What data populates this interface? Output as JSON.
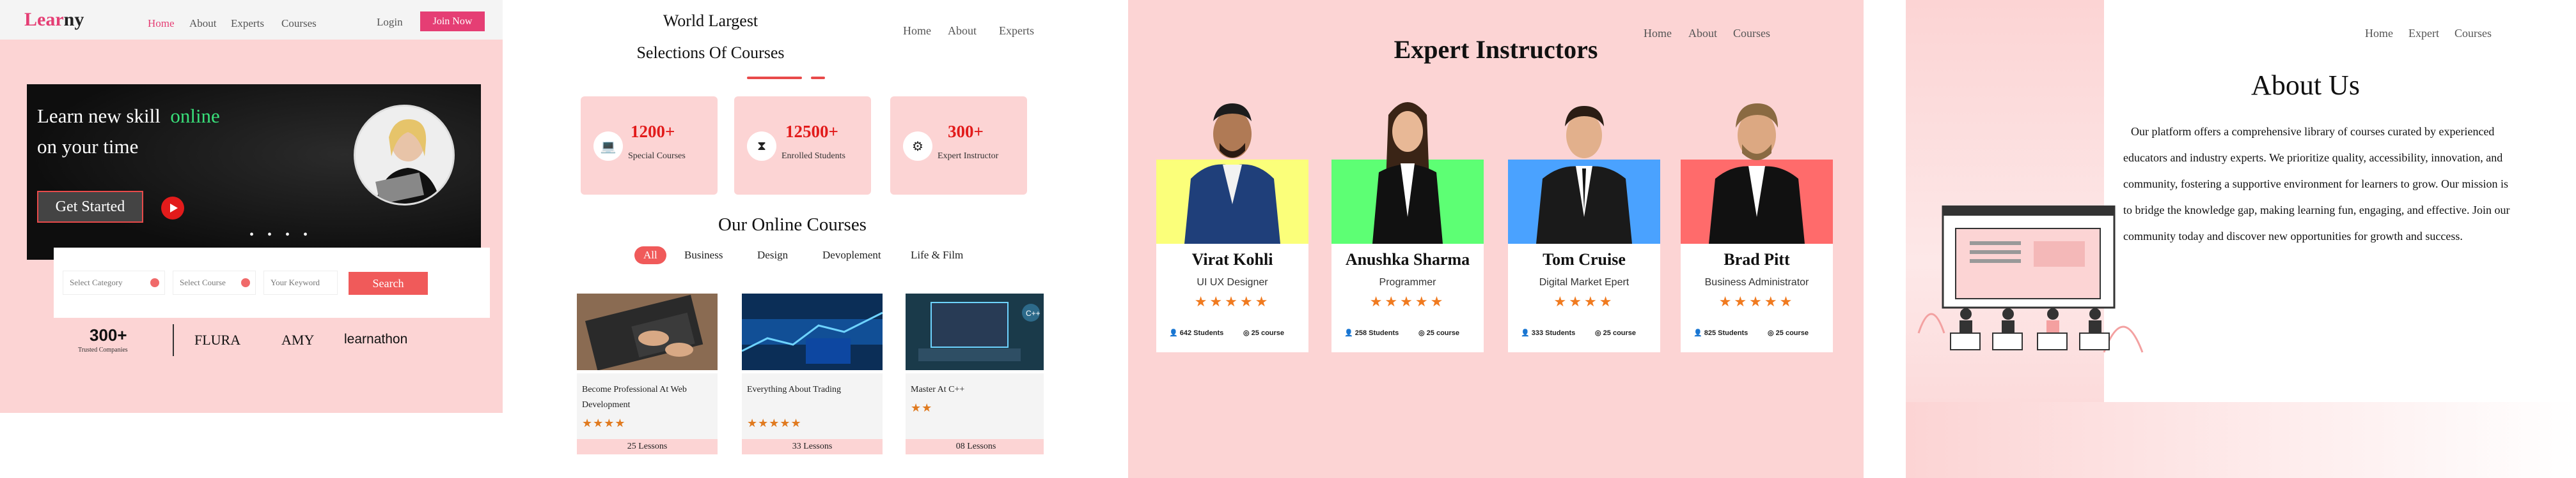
{
  "hero_page": {
    "logo": {
      "part1": "Lear",
      "part2": "ny"
    },
    "nav": [
      "Home",
      "About",
      "Experts",
      "Courses"
    ],
    "login": "Login",
    "join": "Join Now",
    "hero": {
      "line1_a": "Learn new skill",
      "line1_b": "online",
      "line2": "on your time",
      "cta": "Get Started",
      "dots": "• • • •"
    },
    "search": {
      "category": "Select Category",
      "course": "Select Course",
      "keyword": "Your Keyword",
      "button": "Search"
    },
    "trust": {
      "count": "300+",
      "label": "Trusted Companies"
    },
    "brands": [
      "FLURA",
      "AMY",
      "learnathon"
    ],
    "colors": {
      "accent": "#e53e74",
      "pink": "#fcd4d4",
      "highlight": "#39e07a"
    }
  },
  "courses_page": {
    "title_line1": "World Largest",
    "title_line2": "Selections Of Courses",
    "nav": [
      "Home",
      "About",
      "Experts"
    ],
    "stats": [
      {
        "icon": "laptop-icon",
        "value": "1200+",
        "label": "Special Courses"
      },
      {
        "icon": "graduation-icon",
        "value": "12500+",
        "label": "Enrolled Students"
      },
      {
        "icon": "instructor-icon",
        "value": "300+",
        "label": "Expert Instructor"
      }
    ],
    "online_title": "Our Online Courses",
    "filters": [
      "All",
      "Business",
      "Design",
      "Devoplement",
      "Life & Film"
    ],
    "courses": [
      {
        "name": "Become Professional At Web Development",
        "stars": "★★★★",
        "lessons": "25 Lessons"
      },
      {
        "name": "Everything About Trading",
        "stars": "★★★★★",
        "lessons": "33 Lessons"
      },
      {
        "name": "Master At C++",
        "stars": "★★",
        "lessons": "08 Lessons"
      }
    ]
  },
  "experts_page": {
    "title": "Expert Instructors",
    "nav": [
      "Home",
      "About",
      "Courses"
    ],
    "instructors": [
      {
        "name": "Virat Kohli",
        "role": "UI UX Designer",
        "stars": "★★★★★",
        "students": "642 Students",
        "courses": "25 course",
        "color": "#fbff7a"
      },
      {
        "name": "Anushka Sharma",
        "role": "Programmer",
        "stars": "★★★★★",
        "students": "258 Students",
        "courses": "25 course",
        "color": "#5dff74"
      },
      {
        "name": "Tom Cruise",
        "role": "Digital Market Epert",
        "stars": "★★★★",
        "students": "333 Students",
        "courses": "25 course",
        "color": "#4aa2ff"
      },
      {
        "name": "Brad Pitt",
        "role": "Business Administrator",
        "stars": "★★★★★",
        "students": "825 Students",
        "courses": "25 course",
        "color": "#ff6b6b"
      }
    ]
  },
  "about_page": {
    "nav": [
      "Home",
      "Expert",
      "Courses"
    ],
    "title": "About Us",
    "body": "Our platform offers a comprehensive library of courses curated by experienced educators and industry experts. We prioritize quality, accessibility, innovation, and community, fostering a supportive environment for learners to grow. Our mission is to bridge the knowledge gap, making learning fun, engaging, and effective. Join our community today and discover new opportunities for growth and success."
  }
}
